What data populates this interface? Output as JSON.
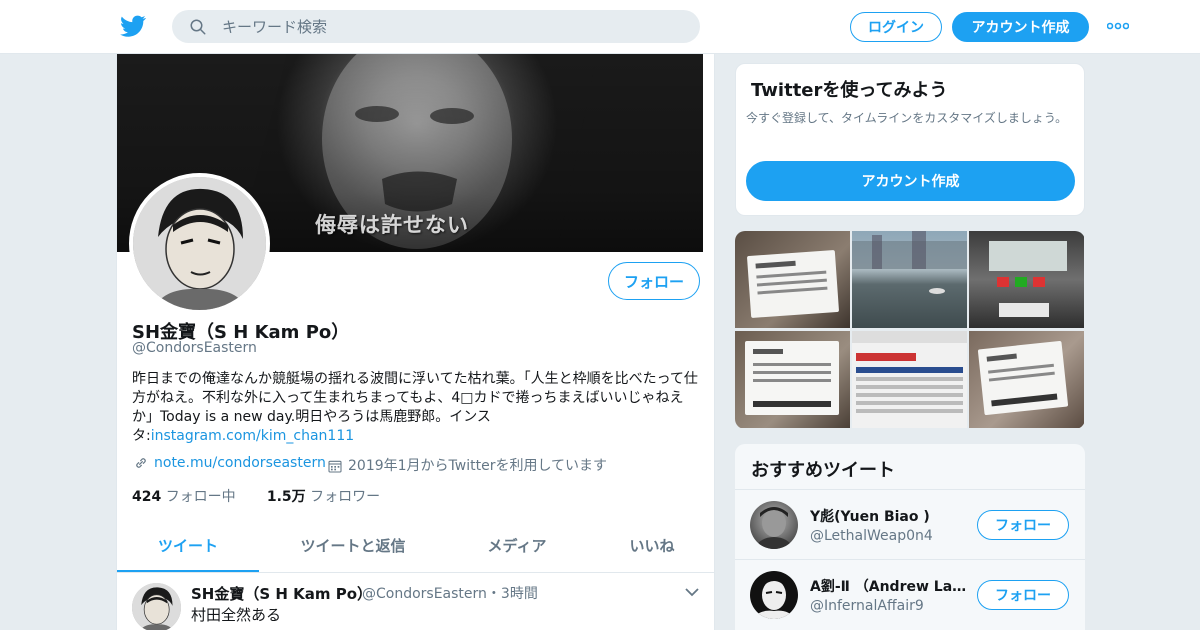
{
  "colors": {
    "accent": "#1da1f2",
    "link": "#1b95e0",
    "muted": "#657786",
    "text": "#14171a",
    "background": "#e6ecf0"
  },
  "topbar": {
    "logo_icon": "twitter-bird-icon",
    "search_placeholder": "キーワード検索",
    "login_label": "ログイン",
    "signup_label": "アカウント作成",
    "more_icon": "more-dots-icon"
  },
  "profile": {
    "banner_caption": "侮辱は許せない",
    "follow_label": "フォロー",
    "name": "SH金寶（S H Kam Po）",
    "handle": "@CondorsEastern",
    "bio_text": "昨日までの俺達なんか競艇場の揺れる波間に浮いてた枯れ葉。「人生と枠順を比べたって仕方がねえ。不利な外に入って生まれちまってもよ、4□カドで捲っちまえばいいじゃねえか」Today is a new day.明日やろうは馬鹿野郎。インスタ:",
    "bio_link": "instagram.com/kim_chan111",
    "website": "note.mu/condorseastern",
    "joined": "2019年1月からTwitterを利用しています",
    "following_count": "424",
    "following_label": "フォロー中",
    "followers_count": "1.5万",
    "followers_label": "フォロワー"
  },
  "tabs": [
    {
      "label": "ツイート",
      "active": true
    },
    {
      "label": "ツイートと返信",
      "active": false
    },
    {
      "label": "メディア",
      "active": false
    },
    {
      "label": "いいね",
      "active": false
    }
  ],
  "tweet": {
    "name": "SH金寶（S H Kam Po）",
    "handle_time": "@CondorsEastern・3時間",
    "text": "村田全然ある"
  },
  "signup_card": {
    "title": "Twitterを使ってみよう",
    "subtitle": "今すぐ登録して、タイムラインをカスタマイズしましょう。",
    "button_label": "アカウント作成"
  },
  "recommended": {
    "title": "おすすめツイート",
    "follow_label": "フォロー",
    "users": [
      {
        "name": "Y彪(Yuen Biao )",
        "handle": "@LethalWeap0n4"
      },
      {
        "name": "A劉-Ⅱ （Andrew Lau ...",
        "handle": "@InfernalAffair9"
      }
    ]
  }
}
